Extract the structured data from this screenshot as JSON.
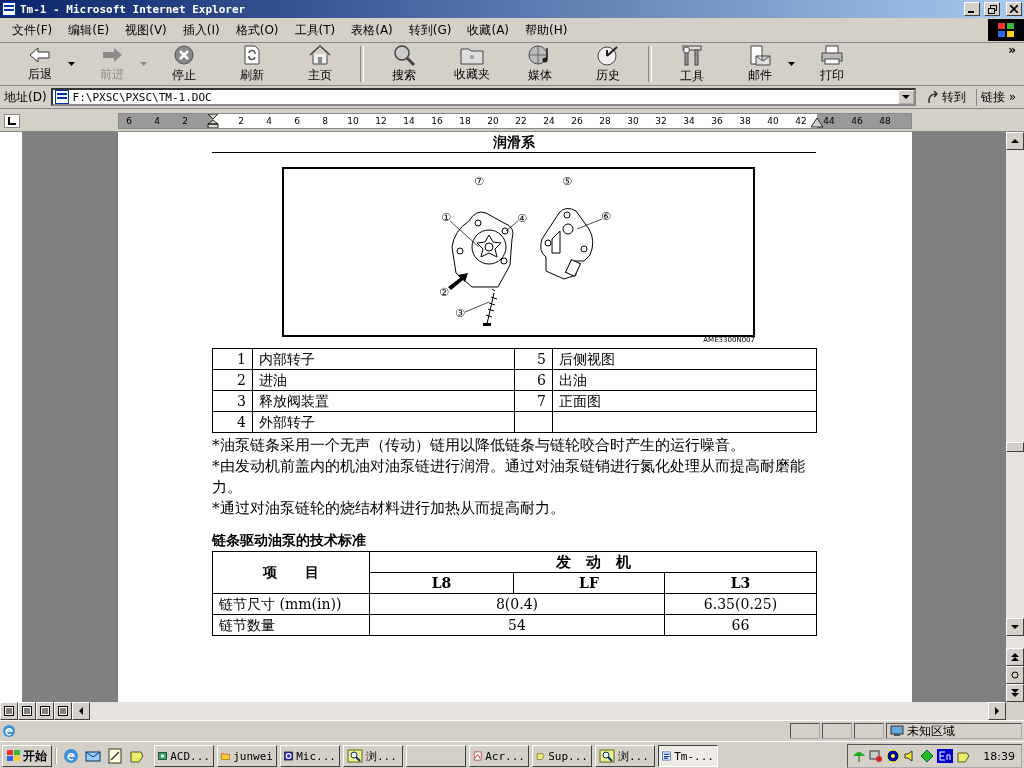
{
  "window": {
    "title": "Tm-1 - Microsoft Internet Explorer"
  },
  "menu": [
    "文件(F)",
    "编辑(E)",
    "视图(V)",
    "插入(I)",
    "格式(O)",
    "工具(T)",
    "表格(A)",
    "转到(G)",
    "收藏(A)",
    "帮助(H)"
  ],
  "toolbar": {
    "groups": [
      [
        {
          "kind": "back",
          "label": "后退",
          "disabled": false,
          "dropdown": true
        },
        {
          "kind": "forward",
          "label": "前进",
          "disabled": true,
          "dropdown": true
        },
        {
          "kind": "stop",
          "label": "停止",
          "disabled": false,
          "dropdown": false
        },
        {
          "kind": "refresh",
          "label": "刷新",
          "disabled": false,
          "dropdown": false
        },
        {
          "kind": "home",
          "label": "主页",
          "disabled": false,
          "dropdown": false
        }
      ],
      [
        {
          "kind": "search",
          "label": "搜索",
          "disabled": false,
          "dropdown": false
        },
        {
          "kind": "favorites",
          "label": "收藏夹",
          "disabled": false,
          "dropdown": false
        },
        {
          "kind": "media",
          "label": "媒体",
          "disabled": false,
          "dropdown": false
        },
        {
          "kind": "history",
          "label": "历史",
          "disabled": false,
          "dropdown": false
        }
      ],
      [
        {
          "kind": "tools",
          "label": "工具",
          "disabled": false,
          "dropdown": false
        },
        {
          "kind": "mail",
          "label": "邮件",
          "disabled": false,
          "dropdown": true
        },
        {
          "kind": "print",
          "label": "打印",
          "disabled": false,
          "dropdown": false
        }
      ]
    ],
    "more": "»"
  },
  "address": {
    "label": "地址(D)",
    "value": "F:\\PXSC\\PXSC\\TM-1.DOC",
    "go": "转到",
    "links": "链接",
    "links_more": "»"
  },
  "ruler": {
    "left_ticks": [
      "6",
      "4",
      "2"
    ],
    "ticks": [
      "2",
      "4",
      "6",
      "8",
      "10",
      "12",
      "14",
      "16",
      "18",
      "20",
      "22",
      "24",
      "26",
      "28",
      "30",
      "32",
      "34",
      "36",
      "38",
      "40",
      "42",
      "44",
      "46",
      "48"
    ]
  },
  "document": {
    "heading": "润滑系",
    "figure": {
      "callouts": [
        "⑦",
        "⑤",
        "①",
        "④",
        "②",
        "③",
        "⑥"
      ],
      "code": "AME3300N007"
    },
    "parts_table": {
      "rows": [
        [
          "1",
          "内部转子",
          "5",
          "后侧视图"
        ],
        [
          "2",
          "进油",
          "6",
          "出油"
        ],
        [
          "3",
          "释放阀装置",
          "7",
          "正面图"
        ],
        [
          "4",
          "外部转子"
        ]
      ]
    },
    "notes": [
      "*油泵链条采用一个无声（传动）链用以降低链条与链轮咬合时产生的运行噪音。",
      "*由发动机前盖内的机油对油泵链进行润滑。通过对油泵链销进行氮化处理从而提高耐磨能力。",
      "*通过对油泵链轮的烧结材料进行加热从而提高耐力。"
    ],
    "spec_title": "链条驱动油泵的技术标准",
    "spec_table": {
      "item_header": "项　　目",
      "engine_header": "发　动　机",
      "engines": [
        "L8",
        "LF",
        "L3"
      ],
      "rows": [
        {
          "label": "链节尺寸 (mm(in))",
          "l8_lf_merged": true,
          "values": [
            "8(0.4)",
            "6.35(0.25)"
          ]
        },
        {
          "label": "链节数量",
          "l8_lf_merged": true,
          "values": [
            "54",
            "66"
          ]
        }
      ]
    }
  },
  "status_bar": {
    "zone": "未知区域"
  },
  "taskbar": {
    "start": "开始",
    "tasks": [
      {
        "label": "ACD...",
        "kind": "viewer",
        "selected": false
      },
      {
        "label": "junwei",
        "kind": "folder",
        "selected": false
      },
      {
        "label": "Mic...",
        "kind": "app",
        "selected": false
      },
      {
        "label": "浏...",
        "kind": "search",
        "selected": false
      },
      {
        "kind": "blank",
        "selected": false
      },
      {
        "label": "Acr...",
        "kind": "pdf",
        "selected": false
      },
      {
        "label": "Sup...",
        "kind": "app2",
        "selected": false
      },
      {
        "label": "浏...",
        "kind": "search",
        "selected": false
      },
      {
        "label": "Tm-...",
        "kind": "doc",
        "selected": true
      }
    ],
    "clock": "18:39"
  }
}
